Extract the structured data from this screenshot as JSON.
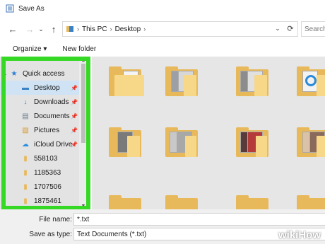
{
  "window": {
    "title": "Save As"
  },
  "nav": {
    "back": "←",
    "forward": "→",
    "recent": "⌄",
    "up": "↑"
  },
  "address": {
    "crumbs": [
      "This PC",
      "Desktop"
    ],
    "sep": "›",
    "refresh": "⟳",
    "dropdown": "⌄"
  },
  "search": {
    "placeholder": "Search"
  },
  "toolbar": {
    "organize": "Organize ▾",
    "new_folder": "New folder"
  },
  "sidebar": {
    "items": [
      {
        "label": "Quick access",
        "icon": "★",
        "pinned": false,
        "expander": "⌄"
      },
      {
        "label": "Desktop",
        "icon": "▬",
        "pinned": true,
        "pin": "📌"
      },
      {
        "label": "Downloads",
        "icon": "↓",
        "pinned": true,
        "pin": "📌"
      },
      {
        "label": "Documents",
        "icon": "▤",
        "pinned": true,
        "pin": "📌"
      },
      {
        "label": "Pictures",
        "icon": "▧",
        "pinned": true,
        "pin": "📌"
      },
      {
        "label": "iCloud Drive",
        "icon": "☁",
        "pinned": true,
        "pin": "📌"
      },
      {
        "label": "558103",
        "icon": "▮",
        "pinned": false
      },
      {
        "label": "1185363",
        "icon": "▮",
        "pinned": false
      },
      {
        "label": "1707506",
        "icon": "▮",
        "pinned": false
      },
      {
        "label": "1875461",
        "icon": "▮",
        "pinned": false
      }
    ]
  },
  "footer": {
    "file_name_label": "File name:",
    "file_name_value": "*.txt",
    "save_type_label": "Save as type:",
    "save_type_value": "Text Documents (*.txt)"
  },
  "watermark": "wikiHow",
  "colors": {
    "highlight": "#35d824",
    "folder": "#e8b95a",
    "folder_front": "#f7d788",
    "selection": "#cfe3f5"
  }
}
